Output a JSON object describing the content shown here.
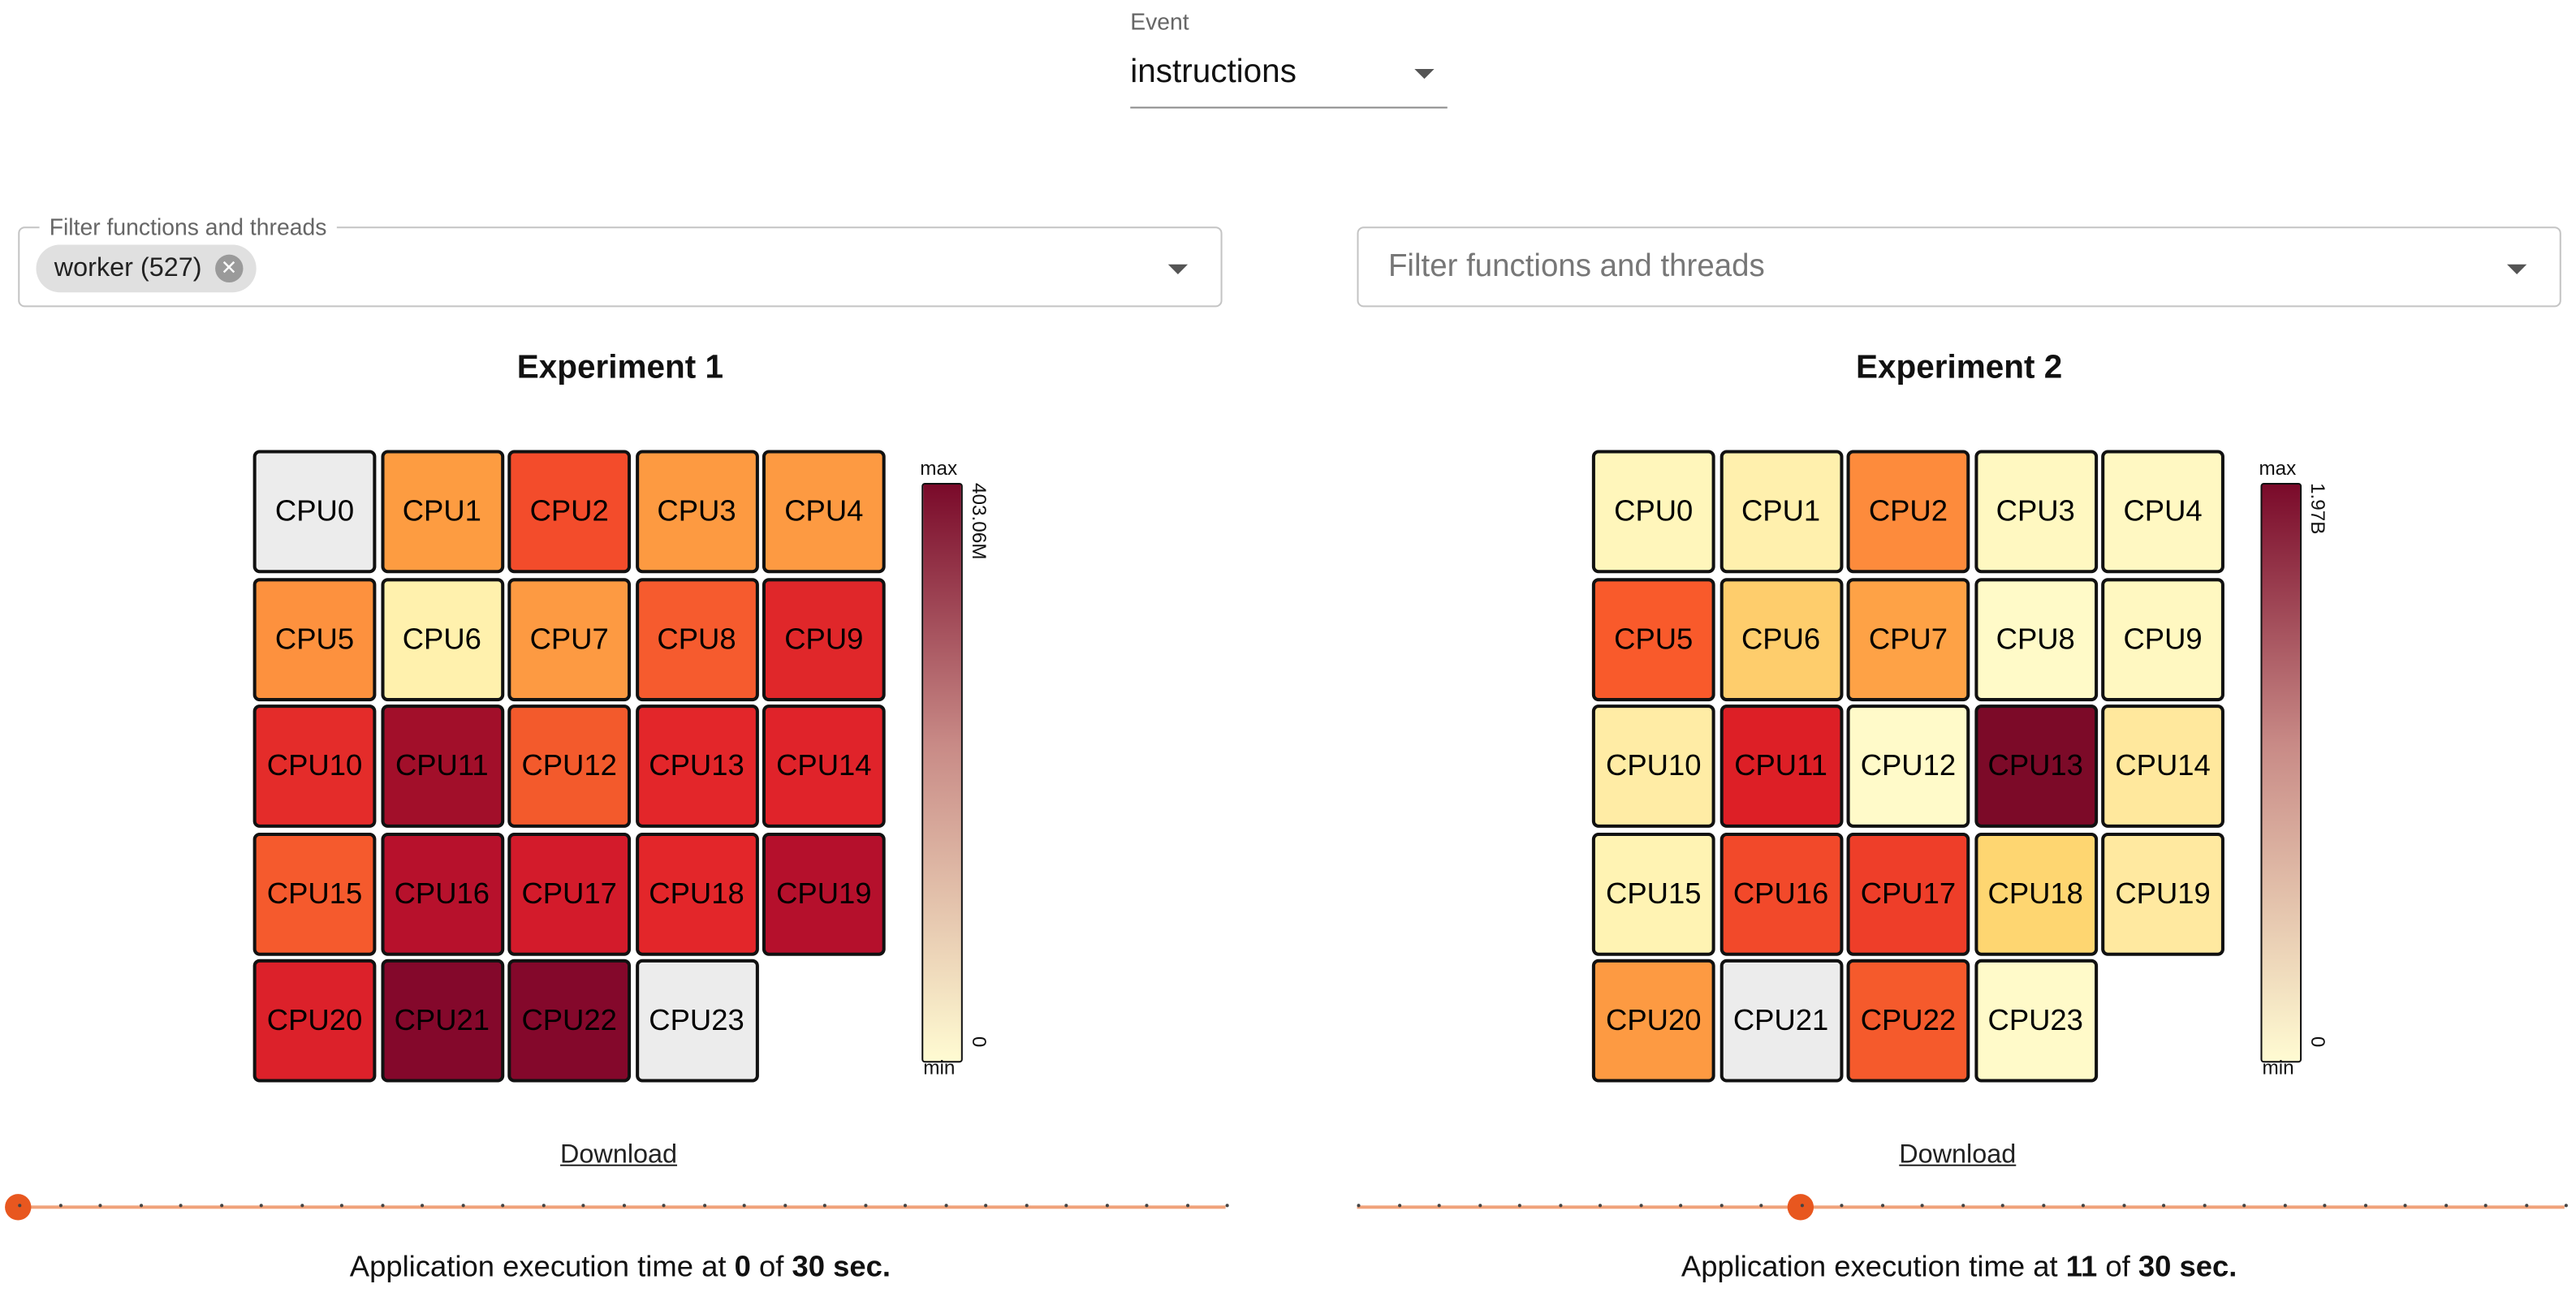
{
  "event": {
    "label": "Event",
    "value": "instructions"
  },
  "panels": [
    {
      "filter": {
        "legend": "Filter functions and threads",
        "chip": "worker (527)",
        "placeholder": ""
      },
      "title": "Experiment 1",
      "legend": {
        "max_label": "max",
        "min_label": "min",
        "max_value": "403.06M",
        "min_value": "0",
        "color_top": "#7a0a2a",
        "color_bottom": "#fffbd2"
      },
      "cells": [
        {
          "label": "CPU0",
          "color": "#ececec"
        },
        {
          "label": "CPU1",
          "color": "#fd9c41"
        },
        {
          "label": "CPU2",
          "color": "#f34c2b"
        },
        {
          "label": "CPU3",
          "color": "#fd9a41"
        },
        {
          "label": "CPU4",
          "color": "#fd9a42"
        },
        {
          "label": "CPU5",
          "color": "#fd913e"
        },
        {
          "label": "CPU6",
          "color": "#fff1ad"
        },
        {
          "label": "CPU7",
          "color": "#fd9a42"
        },
        {
          "label": "CPU8",
          "color": "#f65b2e"
        },
        {
          "label": "CPU9",
          "color": "#e0272a"
        },
        {
          "label": "CPU10",
          "color": "#e42c2a"
        },
        {
          "label": "CPU11",
          "color": "#a20f2a"
        },
        {
          "label": "CPU12",
          "color": "#f35a2c"
        },
        {
          "label": "CPU13",
          "color": "#e3262a"
        },
        {
          "label": "CPU14",
          "color": "#e0232a"
        },
        {
          "label": "CPU15",
          "color": "#f55a2d"
        },
        {
          "label": "CPU16",
          "color": "#b7112c"
        },
        {
          "label": "CPU17",
          "color": "#d31b2b"
        },
        {
          "label": "CPU18",
          "color": "#e3262a"
        },
        {
          "label": "CPU19",
          "color": "#b5102c"
        },
        {
          "label": "CPU20",
          "color": "#dc212a"
        },
        {
          "label": "CPU21",
          "color": "#84082b"
        },
        {
          "label": "CPU22",
          "color": "#84082b"
        },
        {
          "label": "CPU23",
          "color": "#ececec"
        }
      ],
      "download": "Download",
      "slider": {
        "value": 0,
        "max": 30
      },
      "exec": {
        "prefix": "Application execution time at ",
        "current": "0",
        "middle": " of ",
        "total": "30 sec."
      }
    },
    {
      "filter": {
        "legend": "",
        "chip": "",
        "placeholder": "Filter functions and threads"
      },
      "title": "Experiment 2",
      "legend": {
        "max_label": "max",
        "min_label": "min",
        "max_value": "1.97B",
        "min_value": "0",
        "color_top": "#7a0a2a",
        "color_bottom": "#fffbd2"
      },
      "cells": [
        {
          "label": "CPU0",
          "color": "#fff6bb"
        },
        {
          "label": "CPU1",
          "color": "#fff0ad"
        },
        {
          "label": "CPU2",
          "color": "#fd8b3c"
        },
        {
          "label": "CPU3",
          "color": "#fff8c1"
        },
        {
          "label": "CPU4",
          "color": "#fff8c2"
        },
        {
          "label": "CPU5",
          "color": "#f95a2b"
        },
        {
          "label": "CPU6",
          "color": "#fecd6c"
        },
        {
          "label": "CPU7",
          "color": "#fea246"
        },
        {
          "label": "CPU8",
          "color": "#fffac8"
        },
        {
          "label": "CPU9",
          "color": "#fff8c1"
        },
        {
          "label": "CPU10",
          "color": "#ffeca5"
        },
        {
          "label": "CPU11",
          "color": "#dd1f26"
        },
        {
          "label": "CPU12",
          "color": "#fffac9"
        },
        {
          "label": "CPU13",
          "color": "#7c0a28"
        },
        {
          "label": "CPU14",
          "color": "#ffe89d"
        },
        {
          "label": "CPU15",
          "color": "#fff3b3"
        },
        {
          "label": "CPU16",
          "color": "#f2492a"
        },
        {
          "label": "CPU17",
          "color": "#ee3e29"
        },
        {
          "label": "CPU18",
          "color": "#fed671"
        },
        {
          "label": "CPU19",
          "color": "#ffe9a0"
        },
        {
          "label": "CPU20",
          "color": "#fd9a42"
        },
        {
          "label": "CPU21",
          "color": "#ececec"
        },
        {
          "label": "CPU22",
          "color": "#f55a2c"
        },
        {
          "label": "CPU23",
          "color": "#fffac9"
        }
      ],
      "download": "Download",
      "slider": {
        "value": 11,
        "max": 30
      },
      "exec": {
        "prefix": "Application execution time at ",
        "current": "11",
        "middle": " of ",
        "total": "30 sec."
      }
    }
  ]
}
